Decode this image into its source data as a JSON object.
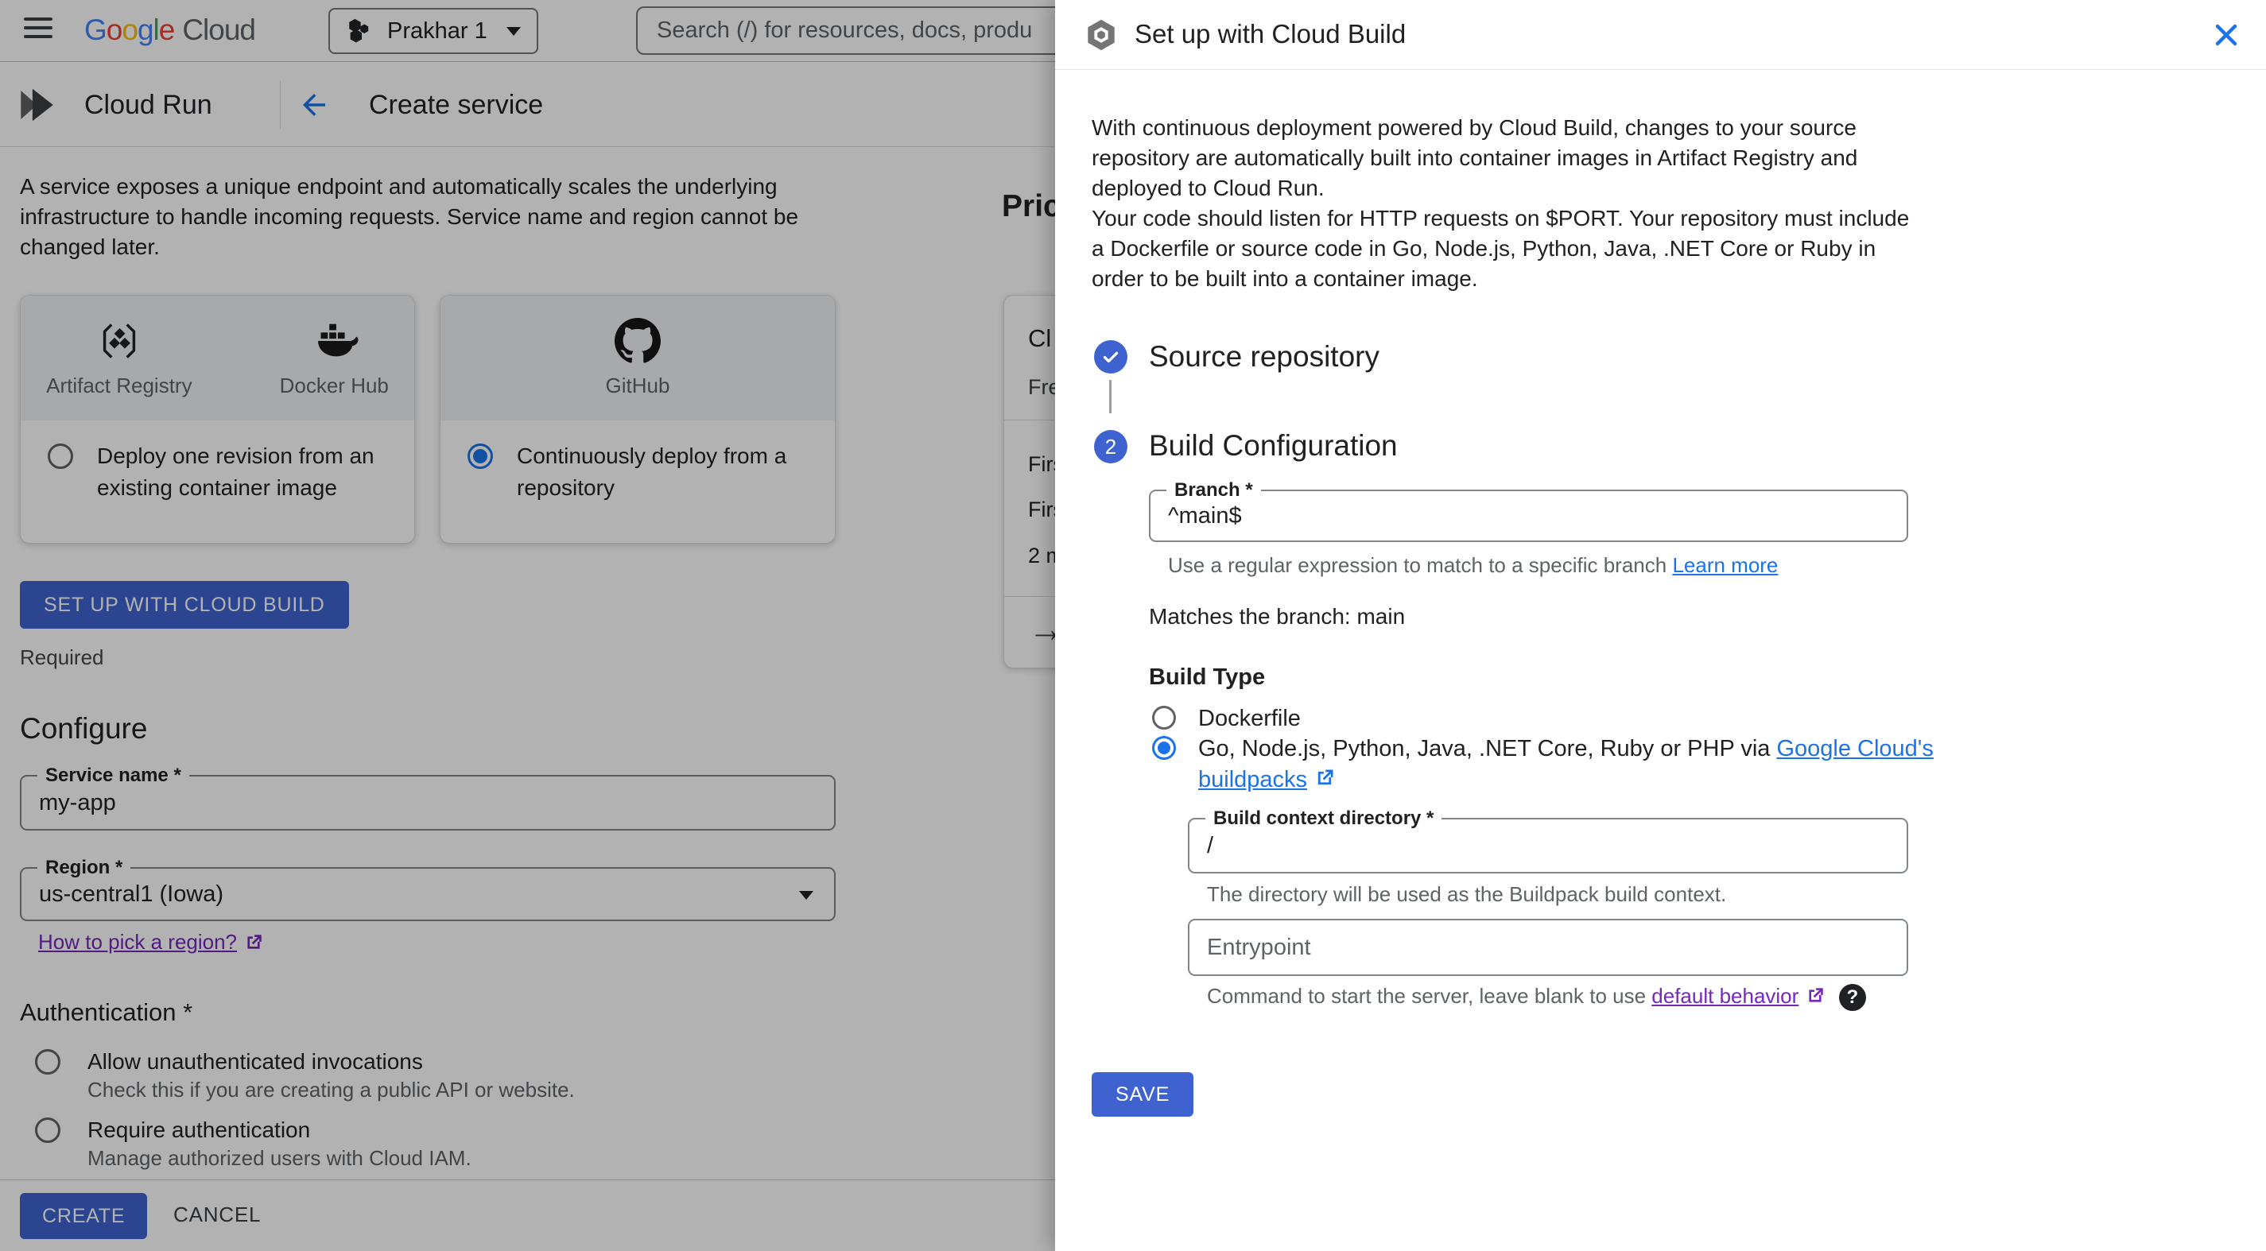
{
  "colors": {
    "accent": "#1a73e8",
    "button": "#3e63d0",
    "purple": "#7627bb",
    "g-blue": "#4285F4",
    "g-red": "#EA4335",
    "g-yellow": "#FBBC05",
    "g-green": "#34A853",
    "cardheader": "#f1f3f4"
  },
  "header": {
    "logo": {
      "l1": "G",
      "l2": "o",
      "l3": "o",
      "l4": "g",
      "l5": "l",
      "l6": "e",
      "word2": "Cloud"
    },
    "project_selector": "Prakhar 1",
    "search_placeholder": "Search (/) for resources, docs, produ"
  },
  "breadcrumb": {
    "product": "Cloud Run",
    "page_title": "Create service"
  },
  "main": {
    "description": "A service exposes a unique endpoint and automatically scales the underlying infrastructure to handle incoming requests. Service name and region cannot be changed later.",
    "cards": {
      "card1": {
        "icon1_label": "Artifact Registry",
        "icon2_label": "Docker Hub",
        "radio_label": "Deploy one revision from an existing container image",
        "selected": false
      },
      "card2": {
        "icon1_label": "GitHub",
        "radio_label": "Continuously deploy from a repository",
        "selected": true
      }
    },
    "setup_button": "SET UP WITH CLOUD BUILD",
    "required_note": "Required",
    "configure": {
      "heading": "Configure",
      "service_name_label": "Service name *",
      "service_name_value": "my-app",
      "region_label": "Region *",
      "region_value": "us-central1 (Iowa)",
      "region_link": "How to pick a region?"
    },
    "authentication": {
      "heading": "Authentication *",
      "option1_label": "Allow unauthenticated invocations",
      "option1_sublabel": "Check this if you are creating a public API or website.",
      "option2_label": "Require authentication",
      "option2_sublabel": "Manage authorized users with Cloud IAM."
    },
    "footer": {
      "create": "CREATE",
      "cancel": "CANCEL"
    }
  },
  "pricing": {
    "heading_fragment": "Pric",
    "card_title_fragment": "Cl",
    "card_subtitle_fragment": "Fre",
    "row1_fragment": "Firs",
    "row2_fragment": "Firs",
    "row3_fragment": "2 m",
    "arrow": "→"
  },
  "panel": {
    "title": "Set up with Cloud Build",
    "description_p1": "With continuous deployment powered by Cloud Build, changes to your source repository are automatically built into container images in Artifact Registry and deployed to Cloud Run.",
    "description_p2": "Your code should listen for HTTP requests on $PORT. Your repository must include a Dockerfile or source code in Go, Node.js, Python, Java, .NET Core or Ruby in order to be built into a container image.",
    "step1_title": "Source repository",
    "step2_number": "2",
    "step2_title": "Build Configuration",
    "branch": {
      "label": "Branch *",
      "value": "^main$",
      "helper_prefix": "Use a regular expression to match to a specific branch ",
      "helper_link": "Learn more"
    },
    "match_note": "Matches the branch: main",
    "build_type": {
      "heading": "Build Type",
      "option1": "Dockerfile",
      "option2_prefix": "Go, Node.js, Python, Java, .NET Core, Ruby or PHP via ",
      "option2_link": "Google Cloud's buildpacks"
    },
    "build_context": {
      "label": "Build context directory *",
      "value": "/",
      "helper": "The directory will be used as the Buildpack build context."
    },
    "entrypoint": {
      "placeholder": "Entrypoint",
      "helper_prefix": "Command to start the server, leave blank to use ",
      "helper_link": "default behavior",
      "help_glyph": "?"
    },
    "save_button": "SAVE"
  }
}
